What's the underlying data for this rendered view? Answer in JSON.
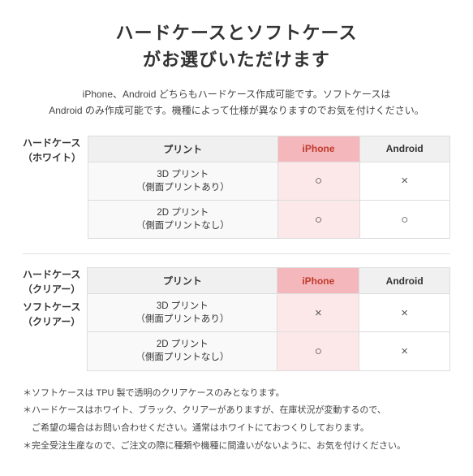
{
  "title": {
    "line1": "ハードケースとソフトケース",
    "line2": "がお選びいただけます"
  },
  "description": "iPhone、Android どちらもハードケース作成可能です。ソフトケースは\nAndroid のみ作成可能です。機種によって仕様が異なりますのでお気を付けください。",
  "section1": {
    "row_header_line1": "ハードケース",
    "row_header_line2": "（ホワイト）",
    "col_print": "プリント",
    "col_iphone": "iPhone",
    "col_android": "Android",
    "rows": [
      {
        "label_line1": "3D プリント",
        "label_line2": "（側面プリントあり）",
        "iphone": "○",
        "android": "×"
      },
      {
        "label_line1": "2D プリント",
        "label_line2": "（側面プリントなし）",
        "iphone": "○",
        "android": "○"
      }
    ]
  },
  "section2": {
    "row_header_line1a": "ハードケース",
    "row_header_line2a": "（クリアー）",
    "row_header_line1b": "ソフトケース",
    "row_header_line2b": "（クリアー）",
    "col_print": "プリント",
    "col_iphone": "iPhone",
    "col_android": "Android",
    "rows": [
      {
        "label_line1": "3D プリント",
        "label_line2": "（側面プリントあり）",
        "iphone": "×",
        "android": "×"
      },
      {
        "label_line1": "2D プリント",
        "label_line2": "（側面プリントなし）",
        "iphone": "○",
        "android": "×"
      }
    ]
  },
  "notes": [
    "＊ソフトケースは TPU 製で透明のクリアケースのみとなります。",
    "＊ハードケースはホワイト、ブラック、クリアーがありますが、在庫状況が変動するので、",
    "　ご希望の場合はお問い合わせください。通常はホワイトにておつくりしております。",
    "＊完全受注生産なので、ご注文の際に種類や機種に間違いがないように、お気を付けください。"
  ]
}
